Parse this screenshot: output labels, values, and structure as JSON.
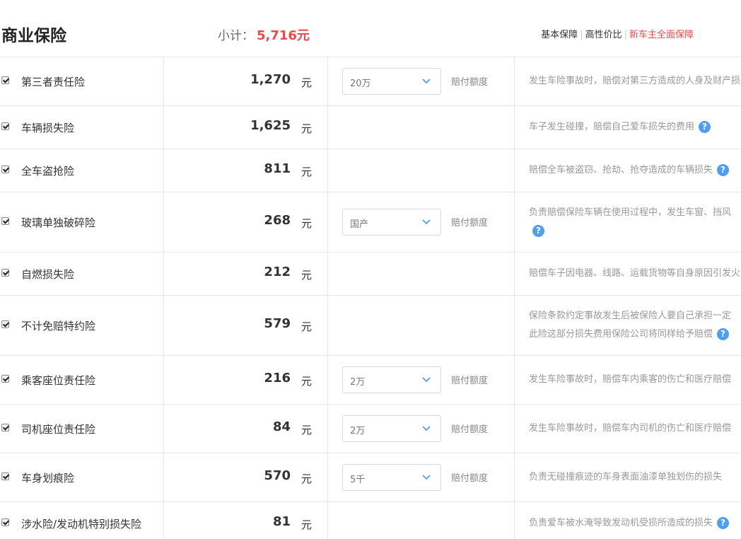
{
  "header": {
    "title": "商业保险",
    "subtotal_label": "小计：",
    "subtotal_value": "5,716元",
    "plans": [
      "基本保障",
      "高性价比",
      "新车主全面保障"
    ]
  },
  "unit_label": "元",
  "limit_label": "赔付额度",
  "help_glyph": "?",
  "colors": {
    "accent_red": "#f04848",
    "help_blue": "#4d9ff2"
  },
  "rows": [
    {
      "name": "第三者责任险",
      "price": "1,270",
      "select": "20万",
      "desc": [
        "发生车险事故时，赔偿对第三方造成的人身及财产损失"
      ],
      "help": false
    },
    {
      "name": "车辆损失险",
      "price": "1,625",
      "select": "",
      "desc": [
        "车子发生碰撞，赔偿自己爱车损失的费用"
      ],
      "help": true
    },
    {
      "name": "全车盗抢险",
      "price": "811",
      "select": "",
      "desc": [
        "赔偿全车被盗窃、抢劫、抢夺造成的车辆损失"
      ],
      "help": true
    },
    {
      "name": "玻璃单独破碎险",
      "price": "268",
      "select": "国产",
      "desc": [
        "负责赔偿保险车辆在使用过程中，发生车窗、挡风",
        ""
      ],
      "help": true
    },
    {
      "name": "自燃损失险",
      "price": "212",
      "select": "",
      "desc": [
        "赔偿车子因电器、线路、运载货物等自身原因引发火灾"
      ],
      "help": false
    },
    {
      "name": "不计免赔特约险",
      "price": "579",
      "select": "",
      "desc": [
        "保险条款约定事故发生后被保险人要自己承担一定",
        "此险这部分损失费用保险公司将同样给予赔偿"
      ],
      "help": true
    },
    {
      "name": "乘客座位责任险",
      "price": "216",
      "select": "2万",
      "desc": [
        "发生车险事故时，赔偿车内乘客的伤亡和医疗赔偿"
      ],
      "help": false
    },
    {
      "name": "司机座位责任险",
      "price": "84",
      "select": "2万",
      "desc": [
        "发生车险事故时，赔偿车内司机的伤亡和医疗赔偿"
      ],
      "help": false
    },
    {
      "name": "车身划痕险",
      "price": "570",
      "select": "5千",
      "desc": [
        "负责无碰撞痕迹的车身表面油漆单独划伤的损失"
      ],
      "help": false
    },
    {
      "name": "涉水险/发动机特别损失险",
      "price": "81",
      "select": "",
      "desc": [
        "负责爱车被水淹导致发动机受损所造成的损失"
      ],
      "help": true
    }
  ]
}
